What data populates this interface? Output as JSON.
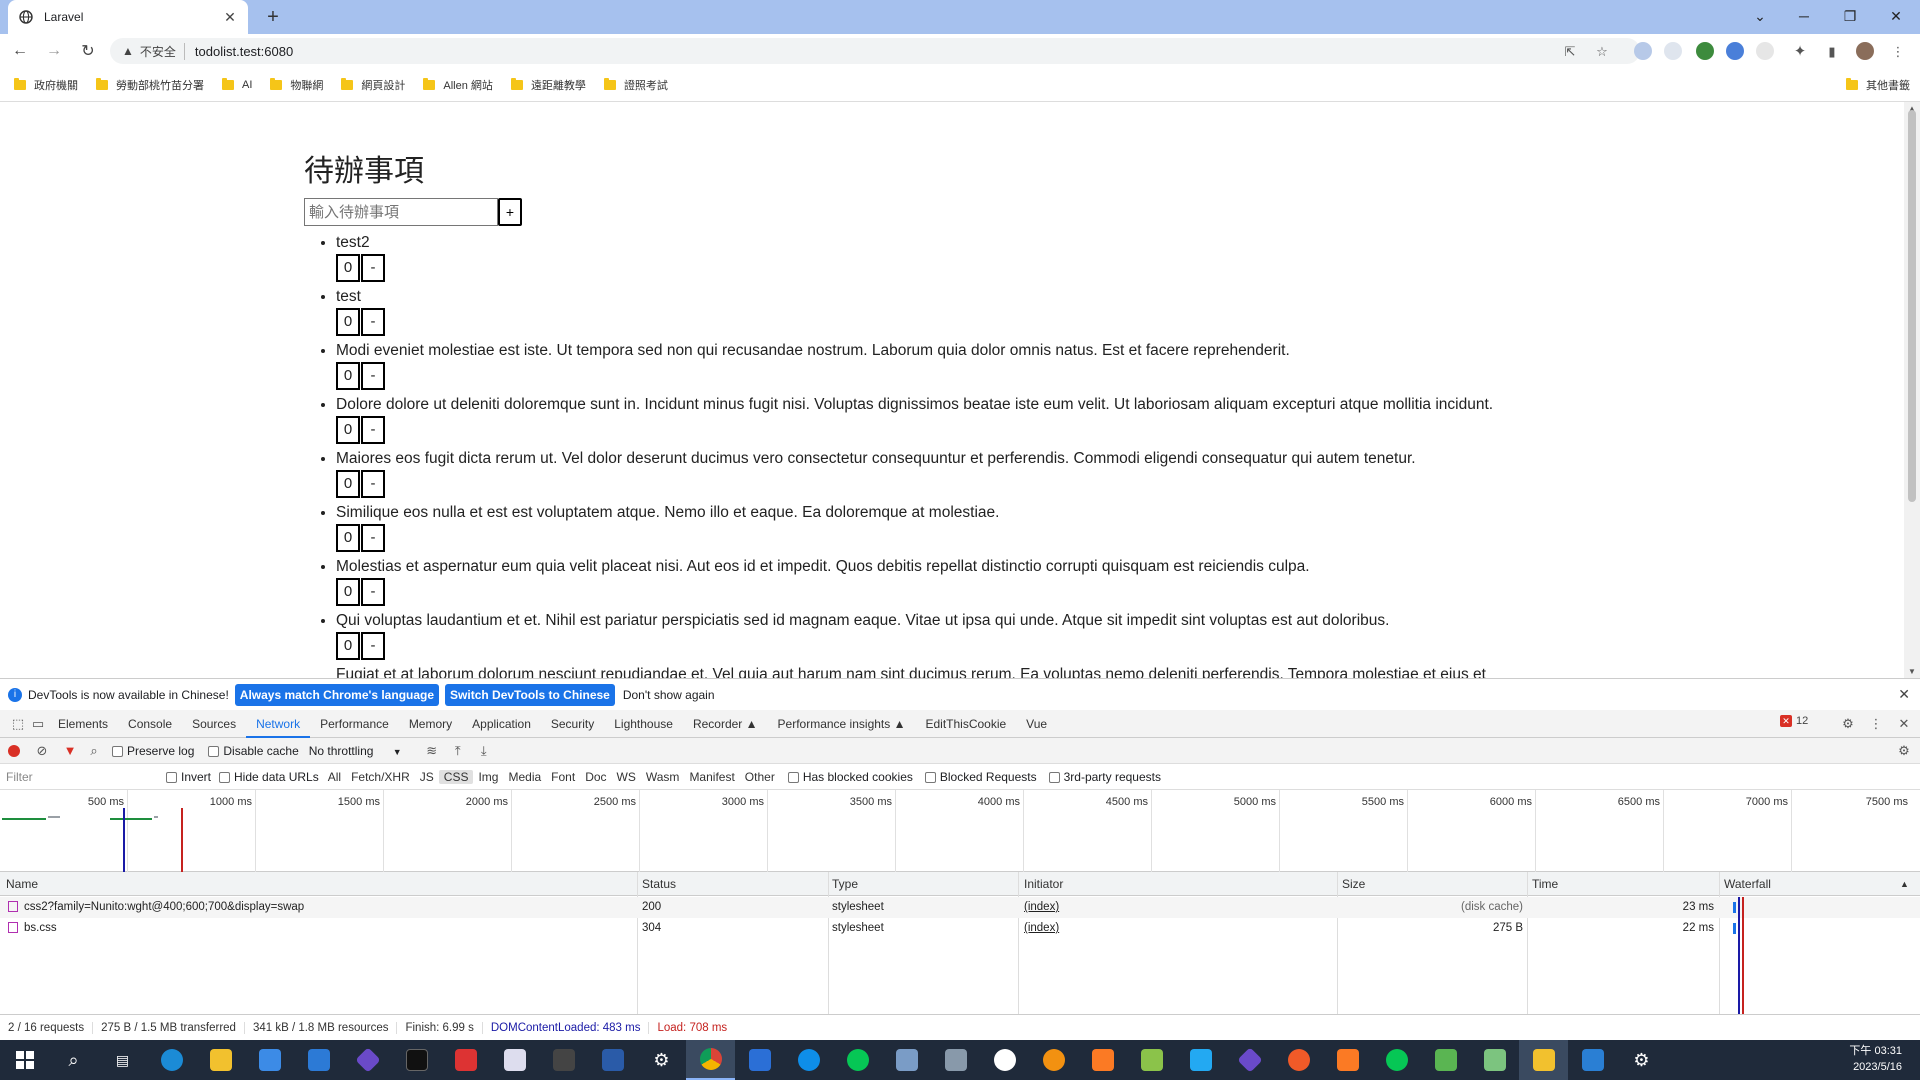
{
  "browser": {
    "tab_title": "Laravel",
    "new_tab_symbol": "+",
    "address": {
      "security_label": "不安全",
      "url": "todolist.test:6080"
    },
    "bookmarks": [
      {
        "label": "政府機關"
      },
      {
        "label": "勞動部桃竹苗分署"
      },
      {
        "label": "AI"
      },
      {
        "label": "物聯網"
      },
      {
        "label": "網頁設計"
      },
      {
        "label": "Allen 網站"
      },
      {
        "label": "遠距離教學"
      },
      {
        "label": "證照考試"
      }
    ],
    "other_bookmarks": "其他書籤"
  },
  "page": {
    "heading": "待辦事項",
    "input_placeholder": "輸入待辦事項",
    "add_button": "+",
    "todos": [
      {
        "text": "test2",
        "count": "0",
        "minus": "-"
      },
      {
        "text": "test",
        "count": "0",
        "minus": "-"
      },
      {
        "text": "Modi eveniet molestiae est iste. Ut tempora sed non qui recusandae nostrum. Laborum quia dolor omnis natus. Est et facere reprehenderit.",
        "count": "0",
        "minus": "-"
      },
      {
        "text": "Dolore dolore ut deleniti doloremque sunt in. Incidunt minus fugit nisi. Voluptas dignissimos beatae iste eum velit. Ut laboriosam aliquam excepturi atque mollitia incidunt.",
        "count": "0",
        "minus": "-"
      },
      {
        "text": "Maiores eos fugit dicta rerum ut. Vel dolor deserunt ducimus vero consectetur consequuntur et perferendis. Commodi eligendi consequatur qui autem tenetur.",
        "count": "0",
        "minus": "-"
      },
      {
        "text": "Similique eos nulla et est est voluptatem atque. Nemo illo et eaque. Ea doloremque at molestiae.",
        "count": "0",
        "minus": "-"
      },
      {
        "text": "Molestias et aspernatur eum quia velit placeat nisi. Aut eos id et impedit. Quos debitis repellat distinctio corrupti quisquam est reiciendis culpa.",
        "count": "0",
        "minus": "-"
      },
      {
        "text": "Qui voluptas laudantium et et. Nihil est pariatur perspiciatis sed id magnam eaque. Vitae ut ipsa qui unde. Atque sit impedit sint voluptas est aut doloribus.",
        "count": "0",
        "minus": "-"
      },
      {
        "text": "Fugiat et at laborum dolorum nesciunt repudiandae et. Vel quia aut harum nam sint ducimus rerum. Ea voluptas nemo deleniti perferendis. Tempora molestiae et eius et",
        "count": "",
        "minus": ""
      }
    ]
  },
  "devtools": {
    "info_text": "DevTools is now available in Chinese!",
    "btn_match": "Always match Chrome's language",
    "btn_switch": "Switch DevTools to Chinese",
    "dont_show": "Don't show again",
    "tabs": [
      "Elements",
      "Console",
      "Sources",
      "Network",
      "Performance",
      "Memory",
      "Application",
      "Security",
      "Lighthouse",
      "Recorder ▲",
      "Performance insights ▲",
      "EditThisCookie",
      "Vue"
    ],
    "active_tab": "Network",
    "error_count": "12",
    "net_toolbar": {
      "preserve_log": "Preserve log",
      "disable_cache": "Disable cache",
      "throttling": "No throttling"
    },
    "filter": {
      "placeholder": "Filter",
      "invert": "Invert",
      "hide_data_urls": "Hide data URLs",
      "types": [
        "All",
        "Fetch/XHR",
        "JS",
        "CSS",
        "Img",
        "Media",
        "Font",
        "Doc",
        "WS",
        "Wasm",
        "Manifest",
        "Other"
      ],
      "selected_type": "CSS",
      "has_blocked": "Has blocked cookies",
      "blocked_requests": "Blocked Requests",
      "third_party": "3rd-party requests"
    },
    "overview_ticks": [
      "500 ms",
      "1000 ms",
      "1500 ms",
      "2000 ms",
      "2500 ms",
      "3000 ms",
      "3500 ms",
      "4000 ms",
      "4500 ms",
      "5000 ms",
      "5500 ms",
      "6000 ms",
      "6500 ms",
      "7000 ms",
      "7500 ms"
    ],
    "columns": [
      "Name",
      "Status",
      "Type",
      "Initiator",
      "Size",
      "Time",
      "Waterfall"
    ],
    "rows": [
      {
        "name": "css2?family=Nunito:wght@400;600;700&display=swap",
        "status": "200",
        "type": "stylesheet",
        "initiator": "(index)",
        "size": "(disk cache)",
        "time": "23 ms"
      },
      {
        "name": "bs.css",
        "status": "304",
        "type": "stylesheet",
        "initiator": "(index)",
        "size": "275 B",
        "time": "22 ms"
      }
    ],
    "status_bar": {
      "requests": "2 / 16 requests",
      "transferred": "275 B / 1.5 MB transferred",
      "resources": "341 kB / 1.8 MB resources",
      "finish": "Finish: 6.99 s",
      "dcl": "DOMContentLoaded: 483 ms",
      "load": "Load: 708 ms"
    },
    "colors": {
      "dcl": "#1a1aa6",
      "load": "#c5221f",
      "accent": "#1a73e8"
    }
  },
  "taskbar": {
    "time": "下午 03:31",
    "date": "2023/5/16"
  }
}
